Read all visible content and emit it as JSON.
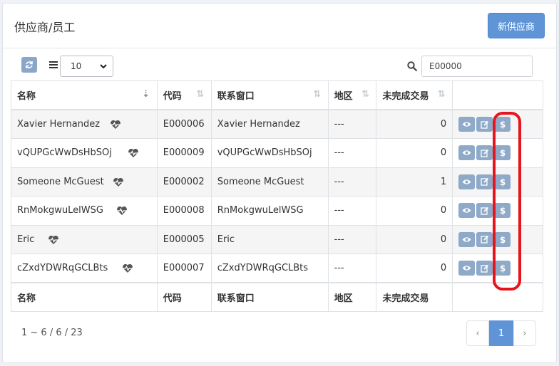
{
  "header": {
    "title": "供应商/员工",
    "new_button": "新供应商"
  },
  "toolbar": {
    "page_size": "10",
    "search_value": "E00000"
  },
  "table": {
    "columns": [
      "名称",
      "代码",
      "联系窗口",
      "地区",
      "未完成交易"
    ],
    "rows": [
      {
        "name": "Xavier Hernandez",
        "code": "E000006",
        "contact": "Xavier Hernandez",
        "region": "---",
        "pending": "0"
      },
      {
        "name": "vQUPGcWwDsHbSOj",
        "code": "E000009",
        "contact": "vQUPGcWwDsHbSOj",
        "region": "---",
        "pending": "0"
      },
      {
        "name": "Someone McGuest",
        "code": "E000002",
        "contact": "Someone McGuest",
        "region": "---",
        "pending": "1"
      },
      {
        "name": "RnMokgwuLelWSG",
        "code": "E000008",
        "contact": "RnMokgwuLelWSG",
        "region": "---",
        "pending": "0"
      },
      {
        "name": "Eric",
        "code": "E000005",
        "contact": "Eric",
        "region": "---",
        "pending": "0"
      },
      {
        "name": "cZxdYDWRqGCLBts",
        "code": "E000007",
        "contact": "cZxdYDWRqGCLBts",
        "region": "---",
        "pending": "0"
      }
    ],
    "row_icons": [
      "heartbeat-icon",
      "view-icon",
      "edit-icon",
      "dollar-icon"
    ]
  },
  "footer": {
    "summary": "1 ~ 6 / 6 / 23",
    "prev": "‹",
    "page": "1",
    "next": "›"
  },
  "colors": {
    "primary": "#5f95d6",
    "action_button": "#8fa9c8",
    "highlight": "#e8141b"
  }
}
